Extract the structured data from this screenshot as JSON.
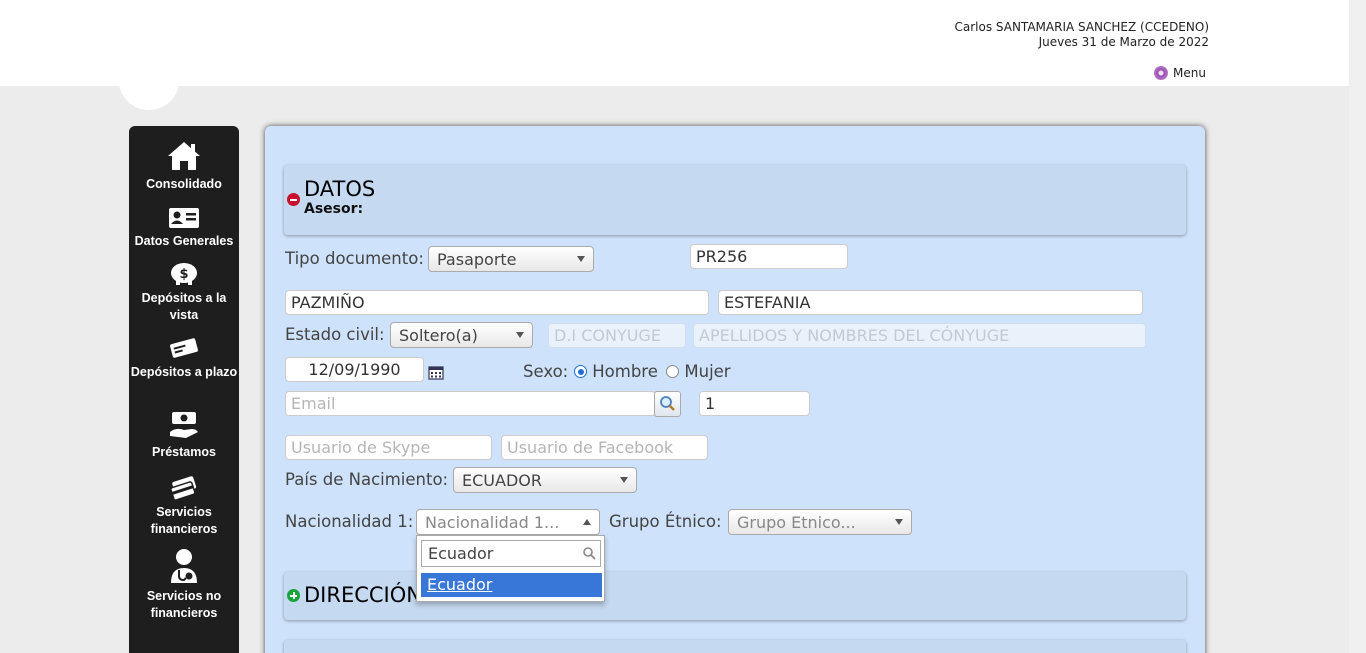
{
  "header": {
    "user_name": "Carlos SANTAMARIA SANCHEZ (CCEDENO)",
    "date": "Jueves 31 de Marzo de 2022",
    "menu_label": "Menu"
  },
  "sidebar": {
    "items": [
      {
        "label": "Consolidado",
        "icon": "home-icon"
      },
      {
        "label": "Datos Generales",
        "icon": "id-card-icon"
      },
      {
        "label": "Depósitos a la vista",
        "icon": "piggy-bank-icon"
      },
      {
        "label": "Depósitos a plazo",
        "icon": "cheque-icon"
      },
      {
        "label": "Préstamos",
        "icon": "loan-hand-icon"
      },
      {
        "label": "Servicios financieros",
        "icon": "cards-icon"
      },
      {
        "label": "Servicios no financieros",
        "icon": "user-service-icon"
      }
    ]
  },
  "datos": {
    "title": "DATOS",
    "subtitle": "Asesor:",
    "tipo_documento_label": "Tipo documento:",
    "tipo_documento_value": "Pasaporte",
    "documento_numero": "PR256",
    "apellidos": "PAZMIÑO",
    "nombres": "ESTEFANIA",
    "estado_civil_label": "Estado civil:",
    "estado_civil_value": "Soltero(a)",
    "di_conyuge_placeholder": "D.I CONYUGE",
    "nombre_conyuge_placeholder": "APELLIDOS Y NOMBRES DEL CÓNYUGE",
    "fecha_nacimiento": "12/09/1990",
    "sexo_label": "Sexo:",
    "sexo_options": [
      "Hombre",
      "Mujer"
    ],
    "sexo_selected": "Hombre",
    "email_placeholder": "Email",
    "numero_field": "1",
    "skype_placeholder": "Usuario de Skype",
    "facebook_placeholder": "Usuario de Facebook",
    "pais_nacimiento_label": "País de Nacimiento:",
    "pais_nacimiento_value": "ECUADOR",
    "nacionalidad_label": "Nacionalidad 1:",
    "nacionalidad_placeholder": "Nacionalidad 1...",
    "grupo_etnico_label": "Grupo Étnico:",
    "grupo_etnico_placeholder": "Grupo Etnico...",
    "dropdown_search_value": "Ecuador",
    "dropdown_options": [
      "Ecuador"
    ]
  },
  "direccion": {
    "title": "DIRECCIÓN"
  },
  "colors": {
    "panel_bg": "#cfe2fb",
    "sidebar_bg": "#1e1e1e",
    "highlight": "#3876d8",
    "collapse_red": "#c8102e",
    "expand_green": "#1aa33a"
  }
}
